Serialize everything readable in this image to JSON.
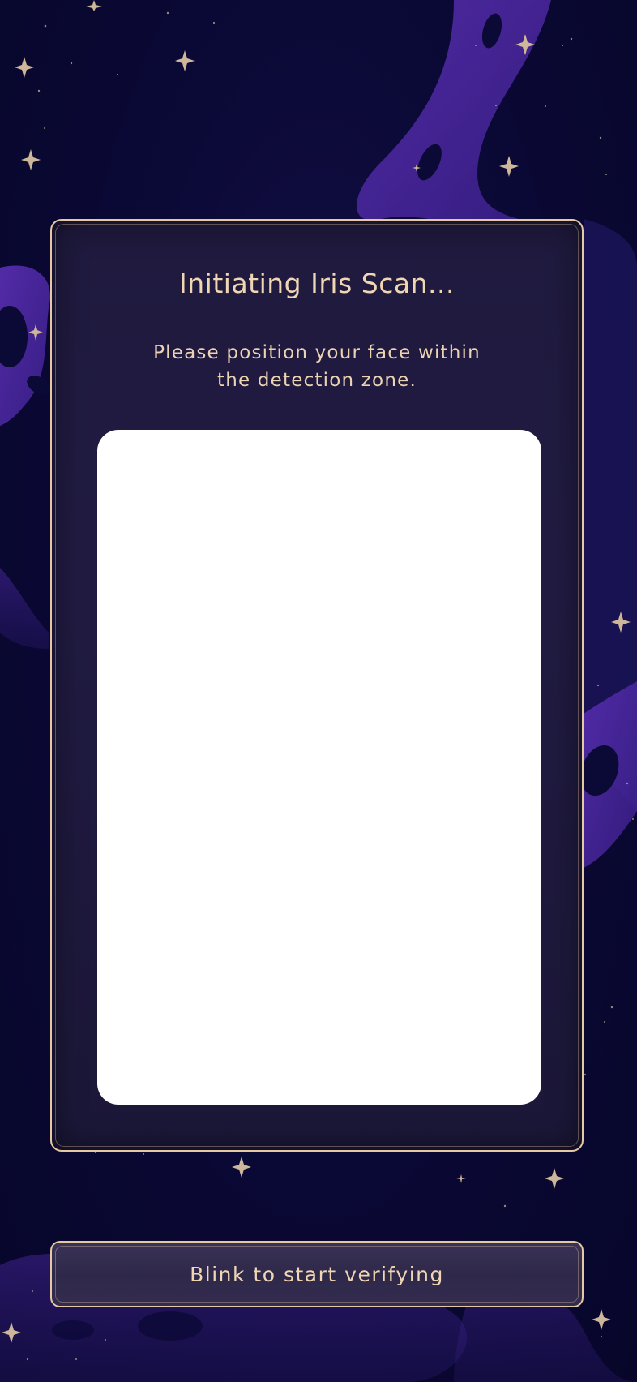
{
  "scan_card": {
    "title": "Initiating Iris Scan...",
    "instruction": "Please position your face within the detection zone."
  },
  "action": {
    "label": "Blink to start verifying"
  },
  "colors": {
    "background": "#0a0830",
    "accent_gold": "#e4c9a4",
    "text": "#f1d6b4",
    "nebula_purple": "#5a2db0",
    "camera_view": "#ffffff"
  },
  "icons": {
    "decor": "sparkle-star-icon"
  }
}
